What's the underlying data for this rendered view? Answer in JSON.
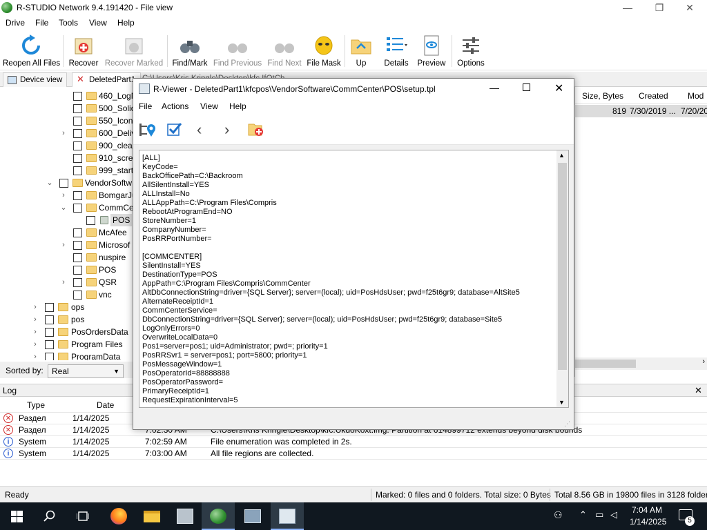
{
  "window": {
    "title": "R-STUDIO Network 9.4.191420 - File view",
    "minimize": "—",
    "maximize": "❐",
    "close": "✕"
  },
  "menu": [
    "Drive",
    "File",
    "Tools",
    "View",
    "Help"
  ],
  "toolbar": {
    "reopen": "Reopen All Files",
    "recover": "Recover",
    "recover_marked": "Recover Marked",
    "find_mark": "Find/Mark",
    "find_previous": "Find Previous",
    "find_next": "Find Next",
    "file_mask": "File Mask",
    "up": "Up",
    "details": "Details",
    "preview": "Preview",
    "options": "Options"
  },
  "tabs": {
    "device_view": "Device view",
    "deleted_part": "DeletedPart1",
    "path_fragment": "C:\\Users\\Kris Kringle\\Desktop\\kfc.IfOtCh"
  },
  "tree": {
    "items": [
      "460_LogM",
      "500_Solid",
      "550_Iconi",
      "600_Deliv",
      "900_clear",
      "910_scree",
      "999_startu",
      "VendorSoftw",
      "BomgarJu",
      "CommCe",
      "POS",
      "McAfee",
      "Microsof",
      "nuspire",
      "POS",
      "QSR",
      "vnc",
      "ops",
      "pos",
      "PosOrdersData",
      "Program Files",
      "ProgramData"
    ]
  },
  "filelist": {
    "col_size": "Size, Bytes",
    "col_created": "Created",
    "col_modified": "Mod",
    "row": {
      "size": "819",
      "created": "7/30/2019 ...",
      "modified": "7/20/20"
    }
  },
  "sort": {
    "label": "Sorted by:",
    "value": "Real"
  },
  "log": {
    "title": "Log",
    "columns": {
      "type": "Type",
      "date": "Date"
    },
    "rows": [
      {
        "type": "Раздел",
        "date": "1/14/2025",
        "time": "",
        "text": ""
      },
      {
        "type": "Раздел",
        "date": "1/14/2025",
        "time": "7:02:30 AM",
        "text": "C:\\Users\\Kris Kringle\\Desktop\\kfc.UkdoKoxt.img: Partition at 614899712 extends beyond disk bounds"
      },
      {
        "type": "System",
        "date": "1/14/2025",
        "time": "7:02:59 AM",
        "text": "File enumeration was completed in 2s."
      },
      {
        "type": "System",
        "date": "1/14/2025",
        "time": "7:03:00 AM",
        "text": "All file regions are collected."
      }
    ]
  },
  "status": {
    "ready": "Ready",
    "marked": "Marked: 0 files and 0 folders. Total size: 0 Bytes",
    "total": "Total 8.56 GB in 19800 files in 3128 folders"
  },
  "taskbar": {
    "time": "7:04 AM",
    "date": "1/14/2025",
    "notif_count": "5"
  },
  "viewer": {
    "title": "R-Viewer - DeletedPart1\\kfcpos\\VendorSoftware\\CommCenter\\POS\\setup.tpl",
    "menu": [
      "File",
      "Actions",
      "View",
      "Help"
    ],
    "lines": [
      "[ALL]",
      "KeyCode=",
      "BackOfficePath=C:\\Backroom",
      "AllSilentInstall=YES",
      "ALLInstall=No",
      "ALLAppPath=C:\\Program Files\\Compris",
      "RebootAtProgramEnd=NO",
      "StoreNumber=1",
      "CompanyNumber=",
      "PosRRPortNumber=",
      "",
      "[COMMCENTER]",
      "SilentInstall=YES",
      "DestinationType=POS",
      "AppPath=C:\\Program Files\\Compris\\CommCenter",
      "AltDbConnectionString=driver={SQL Server}; server=(local); uid=PosHdsUser; pwd=f25t6gr9; database=AltSite5",
      "AlternateReceiptId=1",
      "CommCenterService=",
      "DbConnectionString=driver={SQL Server}; server=(local); uid=PosHdsUser; pwd=f25t6gr9; database=Site5",
      "LogOnlyErrors=0",
      "OverwriteLocalData=0",
      "Pos1=server=pos1; uid=Administrator; pwd=; priority=1",
      "PosRRSvr1 = server=pos1; port=5800; priority=1",
      "PosMessageWindow=1",
      "PosOperatorId=88888888",
      "PosOperatorPassword=",
      "PrimaryReceiptId=1",
      "RequestExpirationInterval=5"
    ]
  }
}
